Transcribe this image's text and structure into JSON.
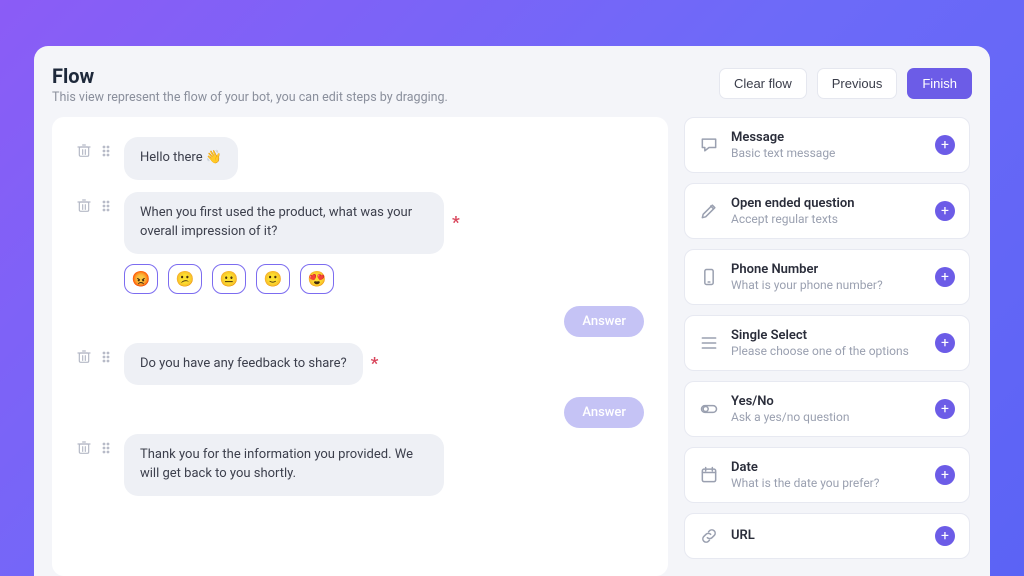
{
  "header": {
    "title": "Flow",
    "subtitle": "This view represent the flow of your bot, you can edit steps by dragging.",
    "clear": "Clear flow",
    "previous": "Previous",
    "finish": "Finish"
  },
  "steps": [
    {
      "text": "Hello there 👋",
      "required": false,
      "emojis": null,
      "answer": null
    },
    {
      "text": "When you first used the product, what was your overall impression of it?",
      "required": true,
      "emojis": [
        "😡",
        "😕",
        "😐",
        "🙂",
        "😍"
      ],
      "answer": "Answer"
    },
    {
      "text": "Do you have any feedback to share?",
      "required": true,
      "emojis": null,
      "answer": "Answer"
    },
    {
      "text": "Thank you for the information you provided. We will get back to you shortly.",
      "required": false,
      "emojis": null,
      "answer": null
    }
  ],
  "blocks": [
    {
      "icon": "message",
      "title": "Message",
      "desc": "Basic text message"
    },
    {
      "icon": "pencil",
      "title": "Open ended question",
      "desc": "Accept regular texts"
    },
    {
      "icon": "phone",
      "title": "Phone Number",
      "desc": "What is your phone number?"
    },
    {
      "icon": "list",
      "title": "Single Select",
      "desc": "Please choose one of the options"
    },
    {
      "icon": "yesno",
      "title": "Yes/No",
      "desc": "Ask a yes/no question"
    },
    {
      "icon": "calendar",
      "title": "Date",
      "desc": "What is the date you prefer?"
    },
    {
      "icon": "link",
      "title": "URL",
      "desc": ""
    }
  ]
}
